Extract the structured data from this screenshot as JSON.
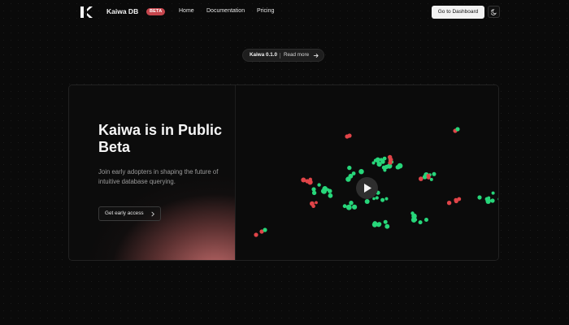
{
  "nav": {
    "brand": "Kaiwa DB",
    "badge": "BETA",
    "links": [
      "Home",
      "Documentation",
      "Pricing"
    ],
    "cta": "Go to Dashboard",
    "logo_icon": "kaiwa-k-logo-icon",
    "theme_icon": "moon-icon"
  },
  "announcement": {
    "version": "Kaiwa 0.1.0",
    "link": "Read more",
    "icon": "arrow-right-icon"
  },
  "hero": {
    "title": "Kaiwa is in Public Beta",
    "subtitle": "Join early adopters in shaping the future of intuitive database querying.",
    "button": "Get early access",
    "button_icon": "chevron-right-icon",
    "play_icon": "play-icon"
  },
  "colors": {
    "background": "#0a0a0a",
    "badge": "#c5464d",
    "dot_green": "#27d67a",
    "dot_red": "#e04448",
    "glow": "#c86e6e"
  }
}
